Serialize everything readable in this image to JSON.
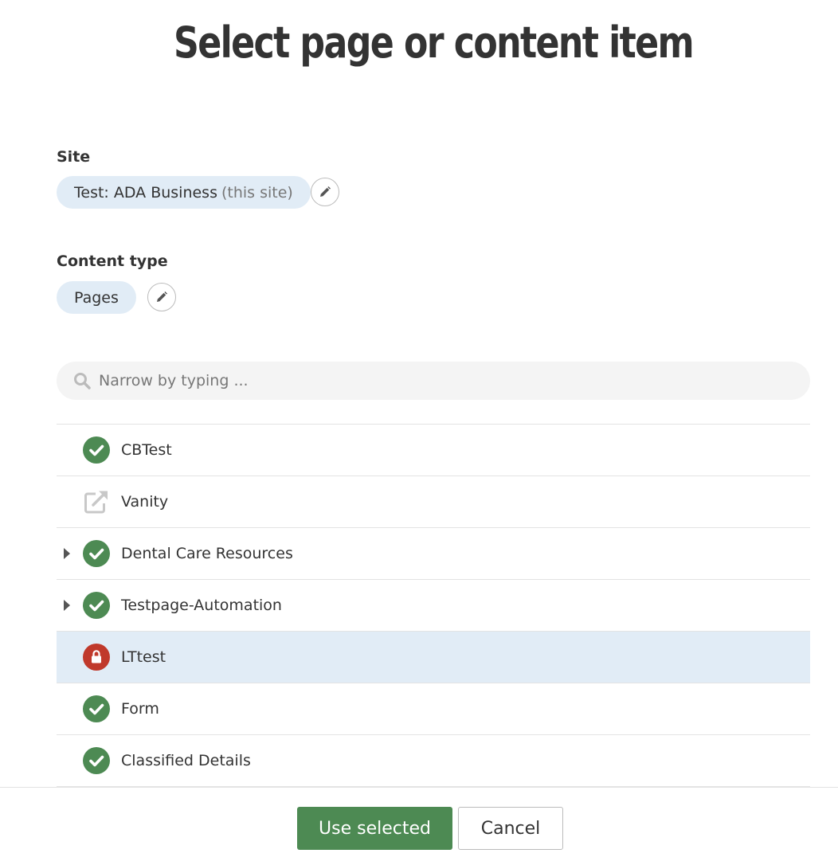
{
  "title": "Select page or content item",
  "site": {
    "label": "Site",
    "value": "Test: ADA Business",
    "suffix": "(this site)"
  },
  "content_type": {
    "label": "Content type",
    "value": "Pages"
  },
  "search": {
    "placeholder": "Narrow by typing ..."
  },
  "items": [
    {
      "label": "CBTest",
      "status": "published",
      "expandable": false,
      "selected": false
    },
    {
      "label": "Vanity",
      "status": "redirect",
      "expandable": false,
      "selected": false
    },
    {
      "label": "Dental Care Resources",
      "status": "published",
      "expandable": true,
      "selected": false
    },
    {
      "label": "Testpage-Automation",
      "status": "published",
      "expandable": true,
      "selected": false
    },
    {
      "label": "LTtest",
      "status": "locked",
      "expandable": false,
      "selected": true
    },
    {
      "label": "Form",
      "status": "published",
      "expandable": false,
      "selected": false
    },
    {
      "label": "Classified Details",
      "status": "published",
      "expandable": false,
      "selected": false
    }
  ],
  "footer": {
    "use_selected_label": "Use selected",
    "cancel_label": "Cancel"
  },
  "colors": {
    "published": "#4d8a53",
    "locked": "#c0392b",
    "redirect": "#c8c8c8",
    "selected_row": "#e1ecf6",
    "primary_button": "#4d8a53"
  }
}
